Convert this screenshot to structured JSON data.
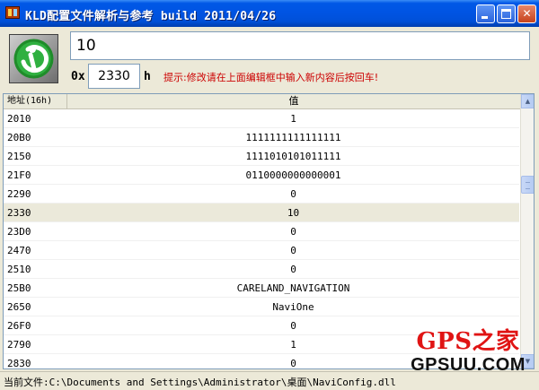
{
  "window": {
    "title": "KLD配置文件解析与参考 build 2011/04/26",
    "minimize_label": "_",
    "maximize_label": "□",
    "close_label": "✕"
  },
  "editor": {
    "value": "10",
    "address_prefix": "0x",
    "address": "2330",
    "address_suffix": "h",
    "hint": "提示:修改请在上面编辑框中输入新内容后按回车!"
  },
  "table": {
    "columns": {
      "address": "地址(16h)",
      "value": "值"
    },
    "rows": [
      {
        "address": "2010",
        "value": "1"
      },
      {
        "address": "20B0",
        "value": "1111111111111111"
      },
      {
        "address": "2150",
        "value": "1111010101011111"
      },
      {
        "address": "21F0",
        "value": "0110000000000001"
      },
      {
        "address": "2290",
        "value": "0"
      },
      {
        "address": "2330",
        "value": "10",
        "selected": true
      },
      {
        "address": "23D0",
        "value": "0"
      },
      {
        "address": "2470",
        "value": "0"
      },
      {
        "address": "2510",
        "value": "0"
      },
      {
        "address": "25B0",
        "value": "CARELAND_NAVIGATION"
      },
      {
        "address": "2650",
        "value": "NaviOne"
      },
      {
        "address": "26F0",
        "value": "0"
      },
      {
        "address": "2790",
        "value": "1"
      },
      {
        "address": "2830",
        "value": "0"
      }
    ]
  },
  "status": {
    "text": "当前文件:C:\\Documents and Settings\\Administrator\\桌面\\NaviConfig.dll"
  },
  "watermark": {
    "top": "GPS之家",
    "bottom": "GPSUU.COM"
  },
  "icons": [
    "app-icon",
    "minimize-icon",
    "maximize-icon",
    "close-icon",
    "logo-icon",
    "scroll-up-icon",
    "scroll-down-icon"
  ]
}
